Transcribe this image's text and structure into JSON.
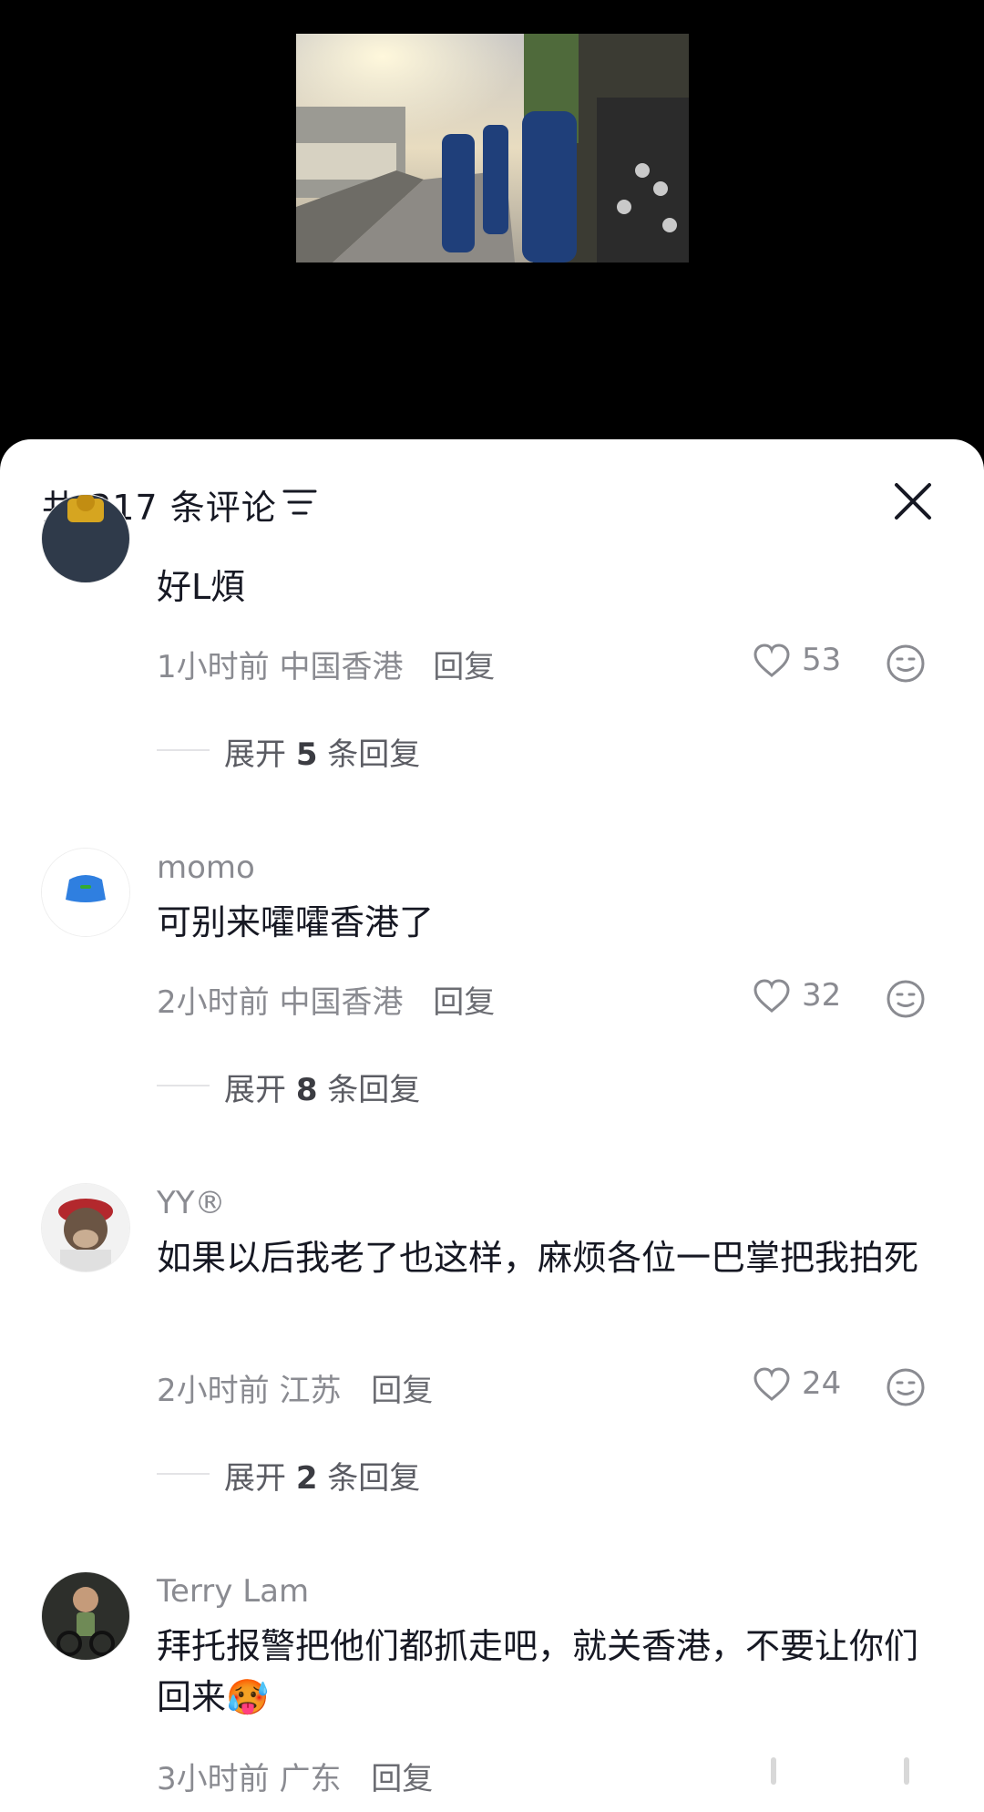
{
  "header": {
    "title": "共 317 条评论"
  },
  "comments": [
    {
      "username": "",
      "text": "好L煩",
      "time": "1小时前",
      "location": "中国香港",
      "reply_label": "回复",
      "likes": "53",
      "expand_prefix": "展开",
      "expand_count": "5",
      "expand_suffix": "条回复"
    },
    {
      "username": "momo",
      "text": "可别来嚯嚯香港了",
      "time": "2小时前",
      "location": "中国香港",
      "reply_label": "回复",
      "likes": "32",
      "expand_prefix": "展开",
      "expand_count": "8",
      "expand_suffix": "条回复"
    },
    {
      "username": "YY®",
      "text": "如果以后我老了也这样，麻烦各位一巴掌把我拍死",
      "time": "2小时前",
      "location": "江苏",
      "reply_label": "回复",
      "likes": "24",
      "expand_prefix": "展开",
      "expand_count": "2",
      "expand_suffix": "条回复"
    },
    {
      "username": "Terry Lam",
      "text": "拜托报警把他们都抓走吧，就关香港，不要让你们回来🥵",
      "time": "3小时前",
      "location": "广东",
      "reply_label": "回复"
    }
  ],
  "colors": {
    "primary_text": "#161823",
    "secondary_text": "#8a8b91",
    "sheet_bg": "#ffffff",
    "backdrop": "#000000"
  },
  "icons": [
    "sort-icon",
    "close-icon",
    "heart-icon",
    "emoji-reaction-icon"
  ]
}
